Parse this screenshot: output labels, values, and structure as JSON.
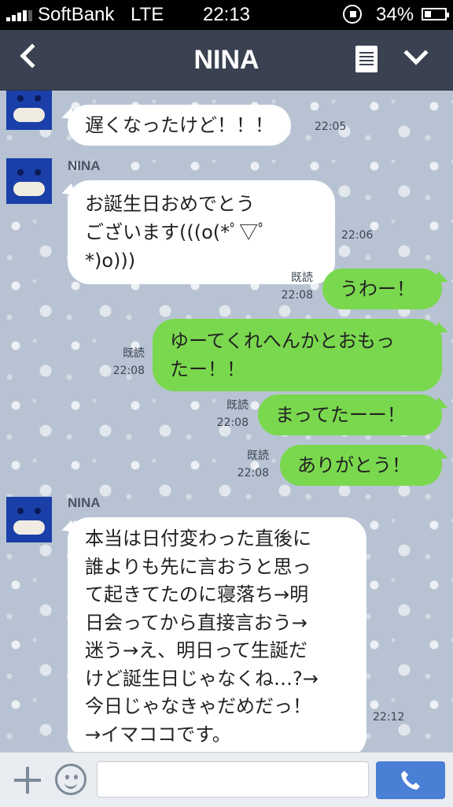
{
  "status_bar": {
    "carrier": "SoftBank",
    "network": "LTE",
    "time": "22:13",
    "battery": "34%",
    "battery_level": 0.34
  },
  "header": {
    "title": "NINA"
  },
  "messages": [
    {
      "sender": "NINA",
      "text": "遅くなったけど！！！",
      "time": "22:05"
    },
    {
      "sender": "NINA",
      "text": "お誕生日おめでとう\nございます(((o(*ﾟ▽ﾟ*)o)))",
      "time": "22:06"
    },
    {
      "text": "うわー！",
      "read": "既読",
      "time": "22:08"
    },
    {
      "text": "ゆーてくれへんかとおもっ\nたー！！",
      "read": "既読",
      "time": "22:08"
    },
    {
      "text": "まってたーー！",
      "read": "既読",
      "time": "22:08"
    },
    {
      "text": "ありがとう！",
      "read": "既読",
      "time": "22:08"
    },
    {
      "sender": "NINA",
      "text": "本当は日付変わった直後に\n誰よりも先に言おうと思っ\nて起きてたのに寝落ち→明\n日会ってから直接言おう→\n迷う→え、明日って生誕だ\nけど誕生日じゃなくね…?→\n今日じゃなきゃだめだっ！\n→イマココです。",
      "time": "22:12"
    }
  ],
  "input": {
    "value": "",
    "placeholder": ""
  },
  "colors": {
    "header_bg": "#3a4251",
    "outgoing_bubble": "#7ad84e",
    "incoming_bubble": "#ffffff",
    "call_button": "#4a7fd6"
  },
  "icons": [
    "back-icon",
    "notes-icon",
    "chevron-down-icon",
    "plus-icon",
    "smile-icon",
    "phone-icon"
  ]
}
